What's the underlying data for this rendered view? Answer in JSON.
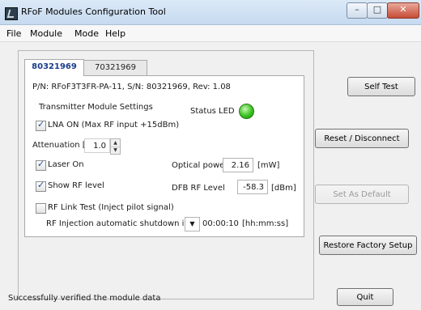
{
  "window": {
    "title": "RFoF Modules Configuration Tool",
    "controls": {
      "minimize": "–",
      "maximize": "□",
      "close": "✕"
    }
  },
  "menu": [
    "File",
    "Module",
    "Mode",
    "Help"
  ],
  "tabs": [
    {
      "label": "80321969",
      "active": true
    },
    {
      "label": "70321969",
      "active": false
    }
  ],
  "module": {
    "info": "P/N: RFoF3T3FR-PA-11,  S/N: 80321969,  Rev: 1.08",
    "section_title": "Transmitter Module Settings",
    "status_led_label": "Status LED",
    "status_led_color": "#37c31f",
    "lna": {
      "label": "LNA ON   (Max RF input +15dBm)",
      "checked": true
    },
    "attenuation": {
      "label": "Attenuation [dB]",
      "value": "1.0"
    },
    "laser": {
      "label": "Laser On",
      "checked": true
    },
    "optical_power": {
      "label": "Optical power",
      "value": "2.16",
      "unit": "[mW]"
    },
    "show_rf": {
      "label": "Show RF level",
      "checked": true
    },
    "dfb_rf": {
      "label": "DFB RF Level",
      "value": "-58.3",
      "unit": "[dBm]"
    },
    "rf_link_test": {
      "label": "RF Link Test (Inject pilot signal)",
      "checked": false
    },
    "rf_injection": {
      "label": "RF Injection automatic shutdown in",
      "dropdown_icon": "▼",
      "value": "00:00:10",
      "unit": "[hh:mm:ss]"
    }
  },
  "buttons": {
    "self_test": "Self Test",
    "reset_disconnect": "Reset / Disconnect",
    "set_as_default": "Set As Default",
    "restore_factory": "Restore Factory Setup",
    "quit": "Quit"
  },
  "spinner": {
    "up": "▲",
    "down": "▼"
  },
  "status_text": "Successfully verified the module data"
}
